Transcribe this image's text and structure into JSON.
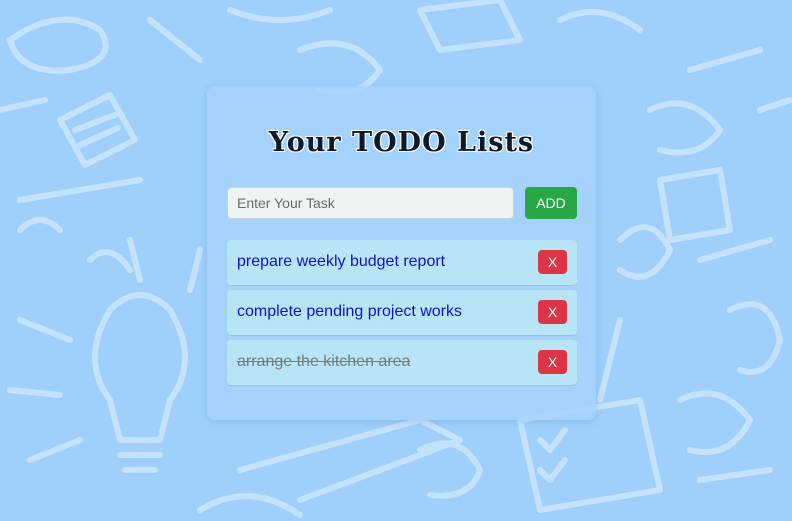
{
  "page": {
    "title": "Your TODO Lists"
  },
  "form": {
    "placeholder": "Enter Your Task",
    "value": "",
    "add_label": "ADD"
  },
  "tasks": [
    {
      "text": "prepare weekly budget report",
      "completed": false,
      "delete_label": "X"
    },
    {
      "text": "complete pending project works",
      "completed": false,
      "delete_label": "X"
    },
    {
      "text": "arrange the kitchen area",
      "completed": true,
      "delete_label": "X"
    }
  ],
  "colors": {
    "background": "#9fd0fb",
    "add_button": "#28a745",
    "delete_button": "#dc3545",
    "task_text": "#1111cc",
    "task_done_text": "#7a7a7a",
    "task_item": "#b7e5f5"
  }
}
